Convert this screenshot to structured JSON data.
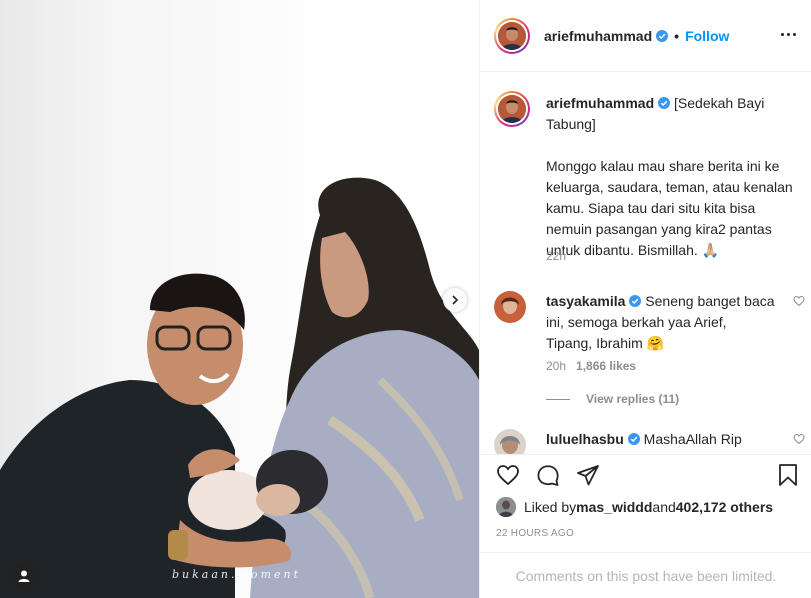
{
  "post": {
    "username": "ariefmuhammad",
    "follow_label": "Follow",
    "dot": "•",
    "watermark": "bukaan.moment"
  },
  "caption": {
    "username": "ariefmuhammad",
    "title": " [Sedekah Bayi Tabung]",
    "body": "Monggo kalau mau share berita ini ke keluarga, saudara, teman, atau kenalan kamu. Siapa tau dari situ kita bisa nemuin pasangan yang kira2 pantas untuk dibantu. Bismillah. 🙏🏼",
    "time": "22h"
  },
  "comments": [
    {
      "username": "tasyakamila",
      "text": " Seneng banget baca ini, semoga berkah yaa Arief, Tipang, Ibrahim 🤗",
      "time": "20h",
      "likes": "1,866 likes"
    },
    {
      "username": "luluelhasbu",
      "text": " MashaAllah Rip"
    }
  ],
  "view_replies": "View replies (11)",
  "likes": {
    "prefix": "Liked by ",
    "user": "mas_widdd",
    "middle": " and ",
    "count": "402,172 others"
  },
  "time_ago": "22 HOURS AGO",
  "comments_limited": "Comments on this post have been limited.",
  "colors": {
    "accent": "#0095f6",
    "verified": "#3897f0",
    "muted": "#8e8e8e",
    "text": "#262626"
  },
  "icons": [
    "more-options-icon",
    "verified-badge-icon",
    "heart-icon",
    "comment-icon",
    "share-icon",
    "bookmark-icon",
    "chevron-right-icon",
    "user-tag-icon"
  ]
}
